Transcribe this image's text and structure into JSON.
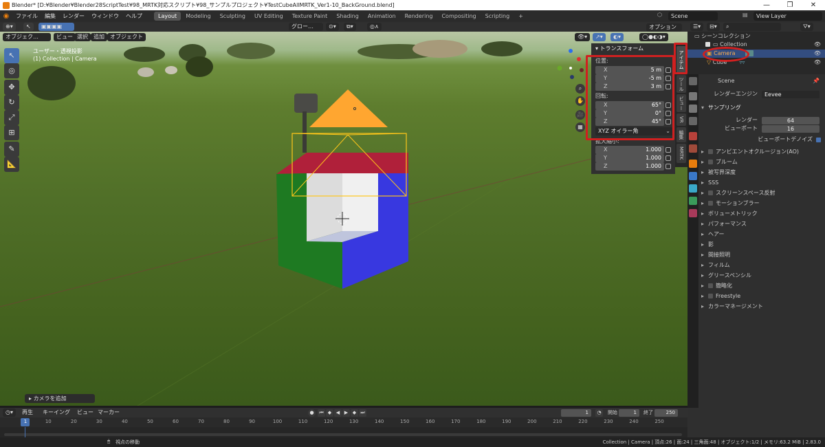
{
  "window": {
    "title": "Blender* [D:¥Blender¥Blender28ScriptTest¥98_MRTK対応スクリプト¥98_サンプルプロジェクト¥TestCubeAllMRTK_Ver1-10_BackGround.blend]",
    "minimize": "—",
    "maximize": "❐",
    "close": "✕"
  },
  "menu": [
    "ファイル",
    "編集",
    "レンダー",
    "ウィンドウ",
    "ヘルプ"
  ],
  "workspaces": [
    "Layout",
    "Modeling",
    "Sculpting",
    "UV Editing",
    "Texture Paint",
    "Shading",
    "Animation",
    "Rendering",
    "Compositing",
    "Scripting",
    "+"
  ],
  "active_workspace": "Layout",
  "scene": {
    "name": "Scene",
    "view_layer": "View Layer"
  },
  "viewport_header": {
    "mode": "オブジェク…",
    "menus": [
      "ビュー",
      "選択",
      "追加",
      "オブジェクト"
    ],
    "orientation": "グロー…",
    "options": "オプション"
  },
  "viewport": {
    "view_name": "ユーザー・透視投影",
    "collection_info": "(1) Collection | Camera",
    "operator_panel": "カメラを追加"
  },
  "npanel": {
    "title": "トランスフォーム",
    "location_label": "位置:",
    "location": [
      {
        "axis": "X",
        "value": "5 m"
      },
      {
        "axis": "Y",
        "value": "-5 m"
      },
      {
        "axis": "Z",
        "value": "3 m"
      }
    ],
    "rotation_label": "回転:",
    "rotation": [
      {
        "axis": "X",
        "value": "65°"
      },
      {
        "axis": "Y",
        "value": "0°"
      },
      {
        "axis": "Z",
        "value": "45°"
      }
    ],
    "rotation_mode": "XYZ オイラー角",
    "scale_label": "拡大縮小:",
    "scale": [
      {
        "axis": "X",
        "value": "1.000"
      },
      {
        "axis": "Y",
        "value": "1.000"
      },
      {
        "axis": "Z",
        "value": "1.000"
      }
    ]
  },
  "sidebar_tabs": [
    "アイテム",
    "ツール",
    "ビュー",
    "VR",
    "編集",
    "MRTK"
  ],
  "outliner": {
    "root": "シーンコレクション",
    "collection": "Collection",
    "items": [
      "Camera",
      "Cube"
    ]
  },
  "properties": {
    "scene_name": "Scene",
    "render_engine_label": "レンダーエンジン",
    "render_engine": "Eevee",
    "sampling": "サンプリング",
    "render_label": "レンダー",
    "render_value": "64",
    "viewport_label": "ビューポート",
    "viewport_value": "16",
    "denoise": "ビューポートデノイズ",
    "panels": [
      {
        "label": "アンビエントオクルージョン(AO)",
        "checkbox": true
      },
      {
        "label": "ブルーム",
        "checkbox": true
      },
      {
        "label": "被写界深度",
        "checkbox": false
      },
      {
        "label": "SSS",
        "checkbox": false
      },
      {
        "label": "スクリーンスペース反射",
        "checkbox": true
      },
      {
        "label": "モーションブラー",
        "checkbox": true
      },
      {
        "label": "ボリューメトリック",
        "checkbox": false
      },
      {
        "label": "パフォーマンス",
        "checkbox": false
      },
      {
        "label": "ヘアー",
        "checkbox": false
      },
      {
        "label": "影",
        "checkbox": false
      },
      {
        "label": "間接照明",
        "checkbox": false
      },
      {
        "label": "フィルム",
        "checkbox": false
      },
      {
        "label": "グリースペンシル",
        "checkbox": false
      },
      {
        "label": "簡略化",
        "checkbox": true
      },
      {
        "label": "Freestyle",
        "checkbox": true
      },
      {
        "label": "カラーマネージメント",
        "checkbox": false
      }
    ]
  },
  "timeline": {
    "menus": [
      "再生",
      "キーイング",
      "ビュー",
      "マーカー"
    ],
    "current_frame": "1",
    "start_label": "開始",
    "start": "1",
    "end_label": "終了",
    "end": "250",
    "ruler": [
      "1",
      "10",
      "20",
      "30",
      "40",
      "50",
      "60",
      "70",
      "80",
      "90",
      "100",
      "110",
      "120",
      "130",
      "140",
      "150",
      "160",
      "170",
      "180",
      "190",
      "200",
      "210",
      "220",
      "230",
      "240",
      "250"
    ]
  },
  "status": {
    "hint": "視点の移動",
    "info": "Collection | Camera | 頂点:26 | 面:24 | 三角面:48 | オブジェクト:1/2 | メモリ:63.2 MiB | 2.83.0"
  }
}
